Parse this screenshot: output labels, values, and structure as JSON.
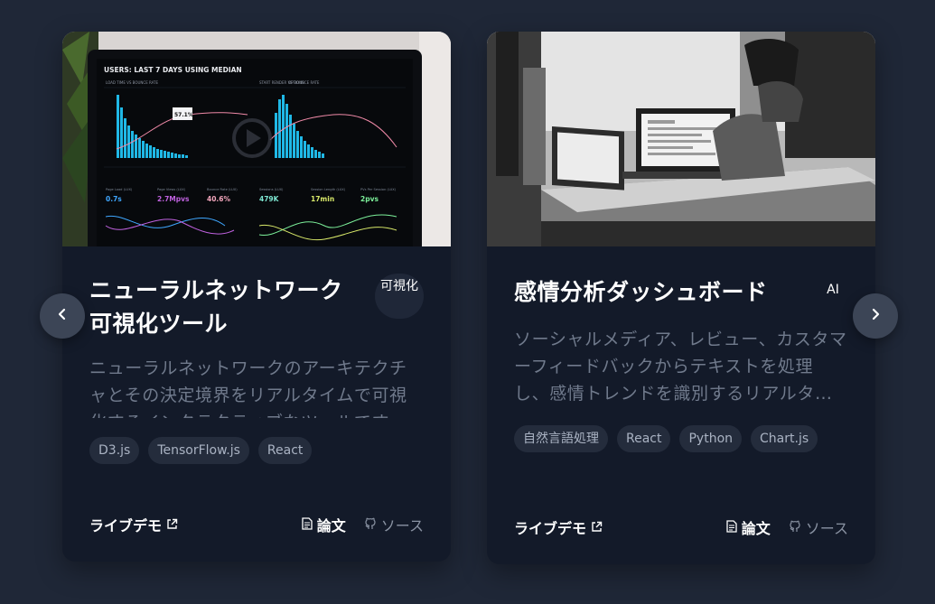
{
  "cards": [
    {
      "title": "ニューラルネットワーク可視化ツール",
      "badge": "可視化",
      "description": "ニューラルネットワークのアーキテクチャとその決定境界をリアルタイムで可視化するインタラクティブなツールです。",
      "tags": [
        "D3.js",
        "TensorFlow.js",
        "React"
      ],
      "demo_label": "ライブデモ",
      "paper_label": "論文",
      "source_label": "ソース",
      "image": {
        "header": "USERS: LAST 7 DAYS USING MEDIAN",
        "panel_left_title": "LOAD TIME VS BOUNCE RATE",
        "panel_right_title": "START RENDER VS BOUNCE RATE",
        "options": "OPTIONS",
        "tooltip_value": "57.1%",
        "metric_labels": [
          "Page Load (LUX)",
          "Page Views (LUX)",
          "Bounce Rate (LUX)",
          "Sessions (LUX)",
          "Session Length (LUX)",
          "PVs Per Session (LUX)"
        ],
        "metric_values": [
          "0.7s",
          "2.7Mpvs",
          "40.6%",
          "479K",
          "17min",
          "2pvs"
        ]
      }
    },
    {
      "title": "感情分析ダッシュボード",
      "badge": "AI",
      "description": "ソーシャルメディア、レビュー、カスタマーフィードバックからテキストを処理し、感情トレンドを識別するリアルタ…",
      "tags": [
        "自然言語処理",
        "React",
        "Python",
        "Chart.js"
      ],
      "demo_label": "ライブデモ",
      "paper_label": "論文",
      "source_label": "ソース"
    }
  ],
  "colors": {
    "background": "#1f2737",
    "card": "#131a29",
    "tag_bg": "#242c3c",
    "accent_cyan": "#1fb8e6"
  },
  "icons": {
    "prev": "chevron-left-icon",
    "next": "chevron-right-icon",
    "external": "external-link-icon",
    "document": "document-icon",
    "github": "github-icon"
  }
}
